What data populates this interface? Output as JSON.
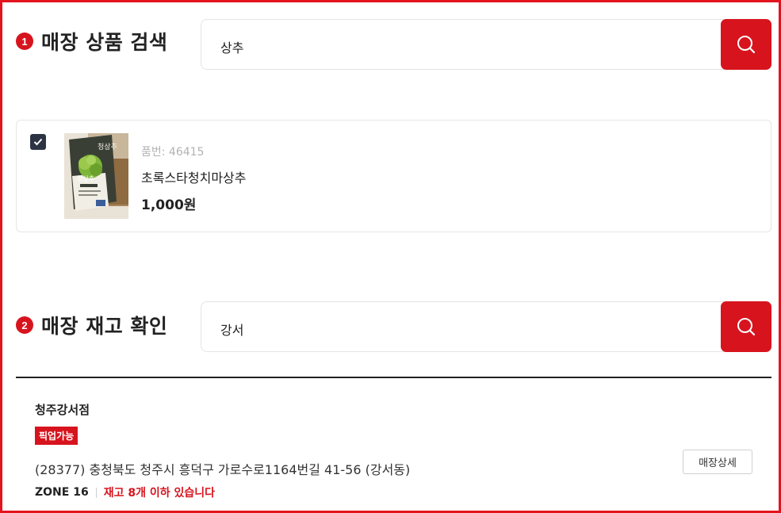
{
  "section1": {
    "number": "1",
    "title": "매장 상품 검색",
    "search_value": "상추"
  },
  "product": {
    "checked": true,
    "sku": "품번: 46415",
    "name": "초록스타청치마상추",
    "price": "1,000원",
    "thumb_labels": [
      "청상추",
      "청상추"
    ]
  },
  "section2": {
    "number": "2",
    "title": "매장 재고 확인",
    "search_value": "강서"
  },
  "store": {
    "name": "청주강서점",
    "pickup_badge": "픽업가능",
    "address": "(28377) 충청북도 청주시 흥덕구 가로수로1164번길 41-56 (강서동)",
    "zone": "ZONE 16",
    "stock": "재고 8개 이하 있습니다",
    "detail_button": "매장상세"
  },
  "colors": {
    "accent": "#d7141e",
    "frame": "#e3141d",
    "checkbox": "#2c3444"
  }
}
